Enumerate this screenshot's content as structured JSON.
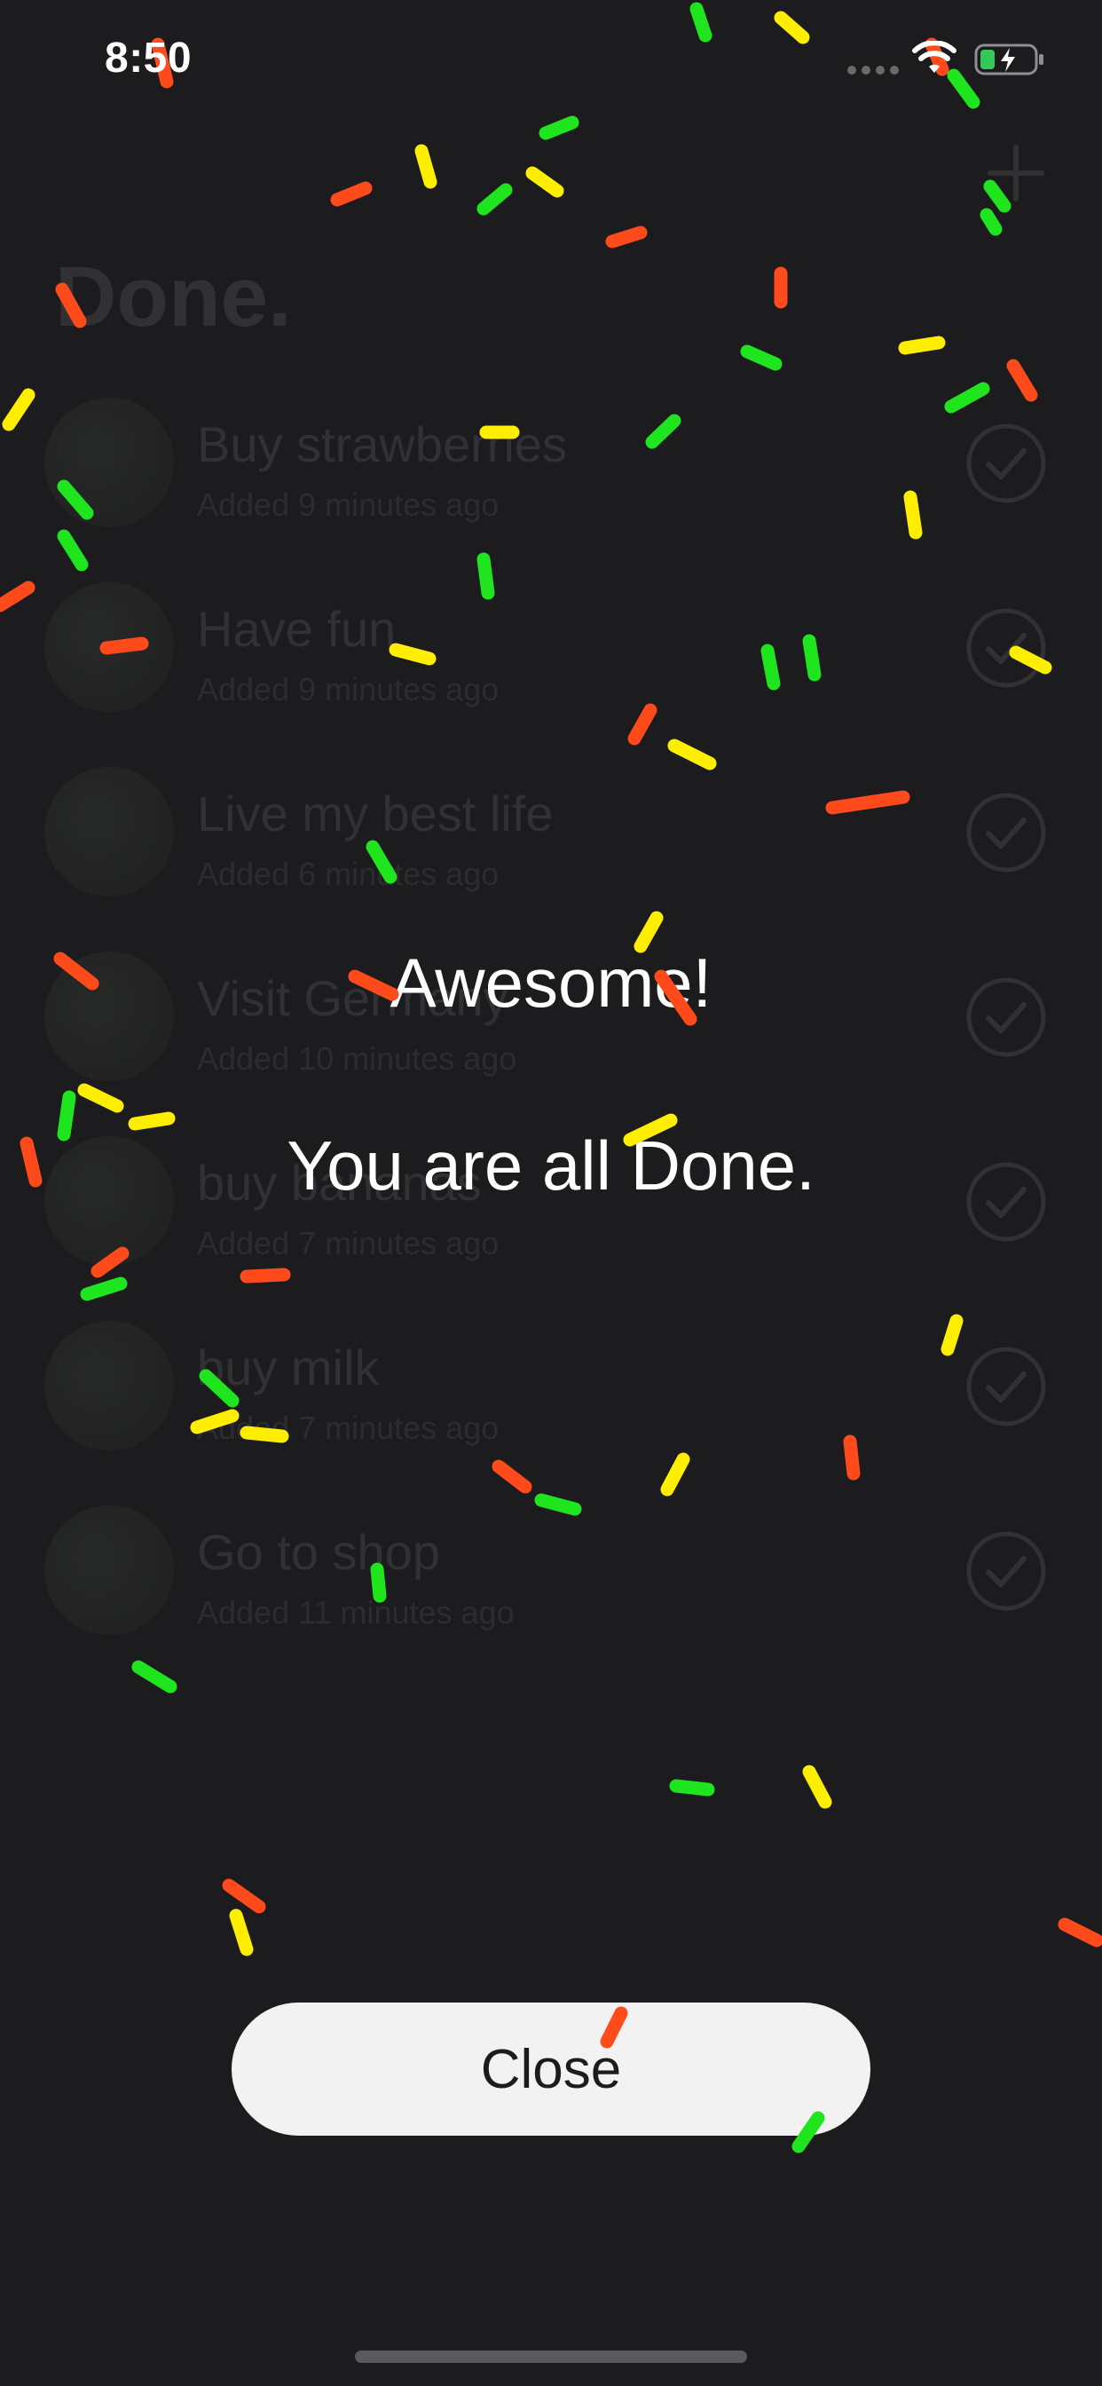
{
  "status_bar": {
    "time": "8:50",
    "wifi_icon": "wifi-icon",
    "battery_icon": "battery-charging-icon",
    "battery_color": "#34c759"
  },
  "background_list": {
    "title": "Done.",
    "add_icon": "plus-icon",
    "items": [
      {
        "title": "Buy strawberries",
        "subtitle": "Added 9 minutes ago",
        "completed": true
      },
      {
        "title": "Have fun",
        "subtitle": "Added 9 minutes ago",
        "completed": true
      },
      {
        "title": "Live my best life",
        "subtitle": "Added 6 minutes ago",
        "completed": true
      },
      {
        "title": "Visit Germany",
        "subtitle": "Added 10 minutes ago",
        "completed": true
      },
      {
        "title": "buy bananas",
        "subtitle": "Added 7 minutes ago",
        "completed": true
      },
      {
        "title": "buy milk",
        "subtitle": "Added 7 minutes ago",
        "completed": true
      },
      {
        "title": "Go to shop",
        "subtitle": "Added 11 minutes ago",
        "completed": true
      }
    ]
  },
  "celebration": {
    "headline": "Awesome!",
    "message": "You are all Done.",
    "close_label": "Close"
  },
  "confetti": {
    "colors": [
      "#ff4a1c",
      "#ffee00",
      "#1ee51e"
    ]
  }
}
